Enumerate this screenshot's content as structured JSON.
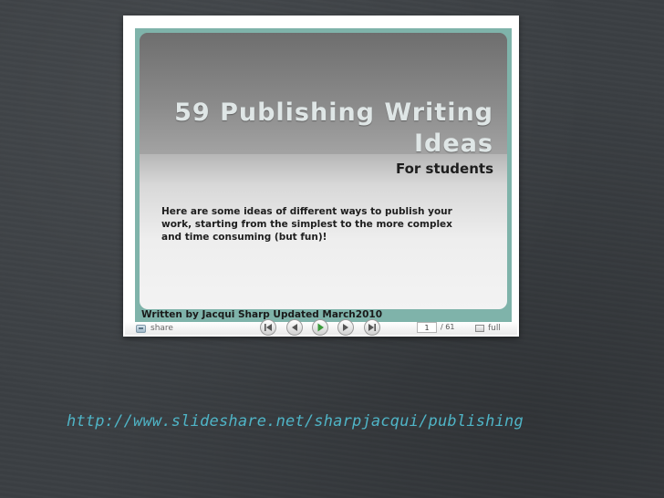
{
  "slide": {
    "title": "59 Publishing Writing Ideas",
    "subtitle": "For students",
    "body": "Here are some ideas of different ways to publish your work, starting from the simplest to the more complex and time consuming (but fun)!",
    "footer": "Written by Jacqui Sharp Updated March2010"
  },
  "player": {
    "share_label": "share",
    "share_icon": "share-icon",
    "nav_icons": [
      "first-slide-icon",
      "previous-slide-icon",
      "play-icon",
      "next-slide-icon",
      "last-slide-icon"
    ],
    "current_page": "1",
    "total_pages": "/ 61",
    "full_label": "full",
    "full_icon": "fullscreen-icon"
  },
  "link": {
    "url": "http://www.slideshare.net/sharpjacqui/publishing"
  },
  "colors": {
    "background": "#3b3f43",
    "slide_frame": "#7fb3aa",
    "link": "#4fb4c6",
    "play_accent": "#3a9a3a"
  }
}
